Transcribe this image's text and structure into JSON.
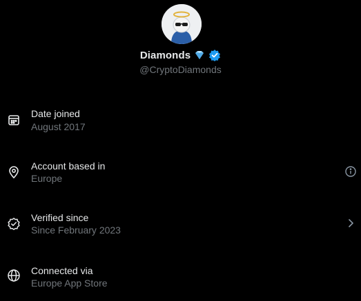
{
  "profile": {
    "display_name": "Diamonds",
    "handle": "@CryptoDiamonds",
    "avatar_icon": "cartoon-avatar-with-halo",
    "name_emoji_icon": "gem-icon",
    "verified_icon": "verified-badge-icon",
    "verified_color": "#1d9bf0"
  },
  "rows": [
    {
      "title": "Date joined",
      "value": "August 2017",
      "icon": "calendar-icon"
    },
    {
      "title": "Account based in",
      "value": "Europe",
      "icon": "location-pin-icon",
      "trailing_icon": "info-icon"
    },
    {
      "title": "Verified since",
      "value": "Since February 2023",
      "icon": "verified-check-icon",
      "trailing_icon": "chevron-right-icon"
    },
    {
      "title": "Connected via",
      "value": "Europe App Store",
      "icon": "globe-icon"
    }
  ],
  "colors": {
    "background": "#000000",
    "primary_text": "#e7e9ea",
    "secondary_text": "#71767b",
    "accent": "#1d9bf0"
  }
}
